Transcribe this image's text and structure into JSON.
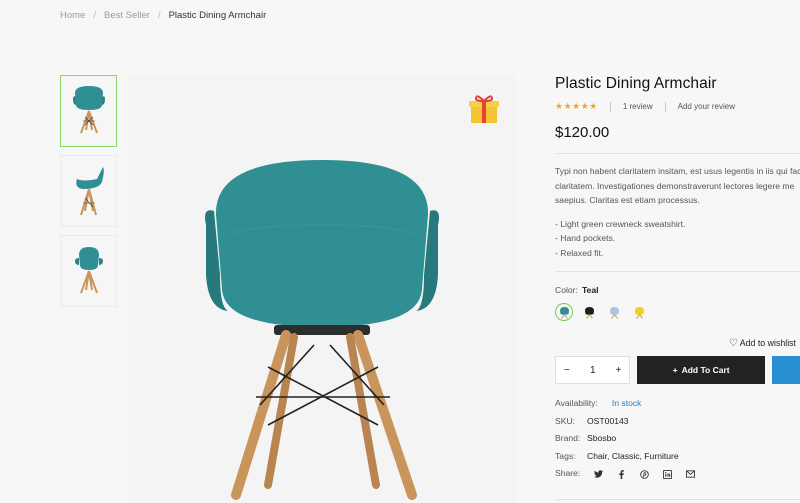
{
  "breadcrumb": {
    "items": [
      "Home",
      "Best Seller"
    ],
    "separator": "/",
    "current": "Plastic Dining Armchair"
  },
  "product": {
    "title": "Plastic Dining Armchair",
    "stars": "★★★★★",
    "rating": 5,
    "review_count": "1 review",
    "add_review": "Add your review",
    "price": "$120.00",
    "description": [
      "Typi non habent claritatem insitam, est usus legentis in iis qui fac",
      "claritatem. Investigationes demonstraverunt lectores legere me",
      "saepius. Claritas est etiam processus."
    ],
    "bullets": [
      "- Light green crewneck sweatshirt.",
      "- Hand pockets.",
      "- Relaxed fit."
    ],
    "color_label": "Color:",
    "color_value": "Teal",
    "swatch_colors": [
      "#2f8f93",
      "#1e1e1e",
      "#a9c7e3",
      "#f2cf1f"
    ],
    "wishlist": "Add to wishlist",
    "qty": "1",
    "qty_minus": "−",
    "qty_plus": "+",
    "add_to_cart": "Add To Cart",
    "add_icon": "+",
    "availability_label": "Availability:",
    "availability_value": "In stock",
    "sku_label": "SKU:",
    "sku_value": "OST00143",
    "brand_label": "Brand:",
    "brand_value": "Sbosbo",
    "tags_label": "Tags:",
    "tags_value": "Chair, Classic, Furniture",
    "share_label": "Share:",
    "share_icons": [
      "twitter-icon",
      "facebook-icon",
      "pinterest-icon",
      "linkedin-icon",
      "email-icon"
    ]
  },
  "colors": {
    "accent_green": "#8fd66a",
    "chair_teal": "#2f8f93",
    "stock_blue": "#2a7fc6",
    "button_dark": "#222222",
    "buy_blue": "#2a8fd1"
  }
}
